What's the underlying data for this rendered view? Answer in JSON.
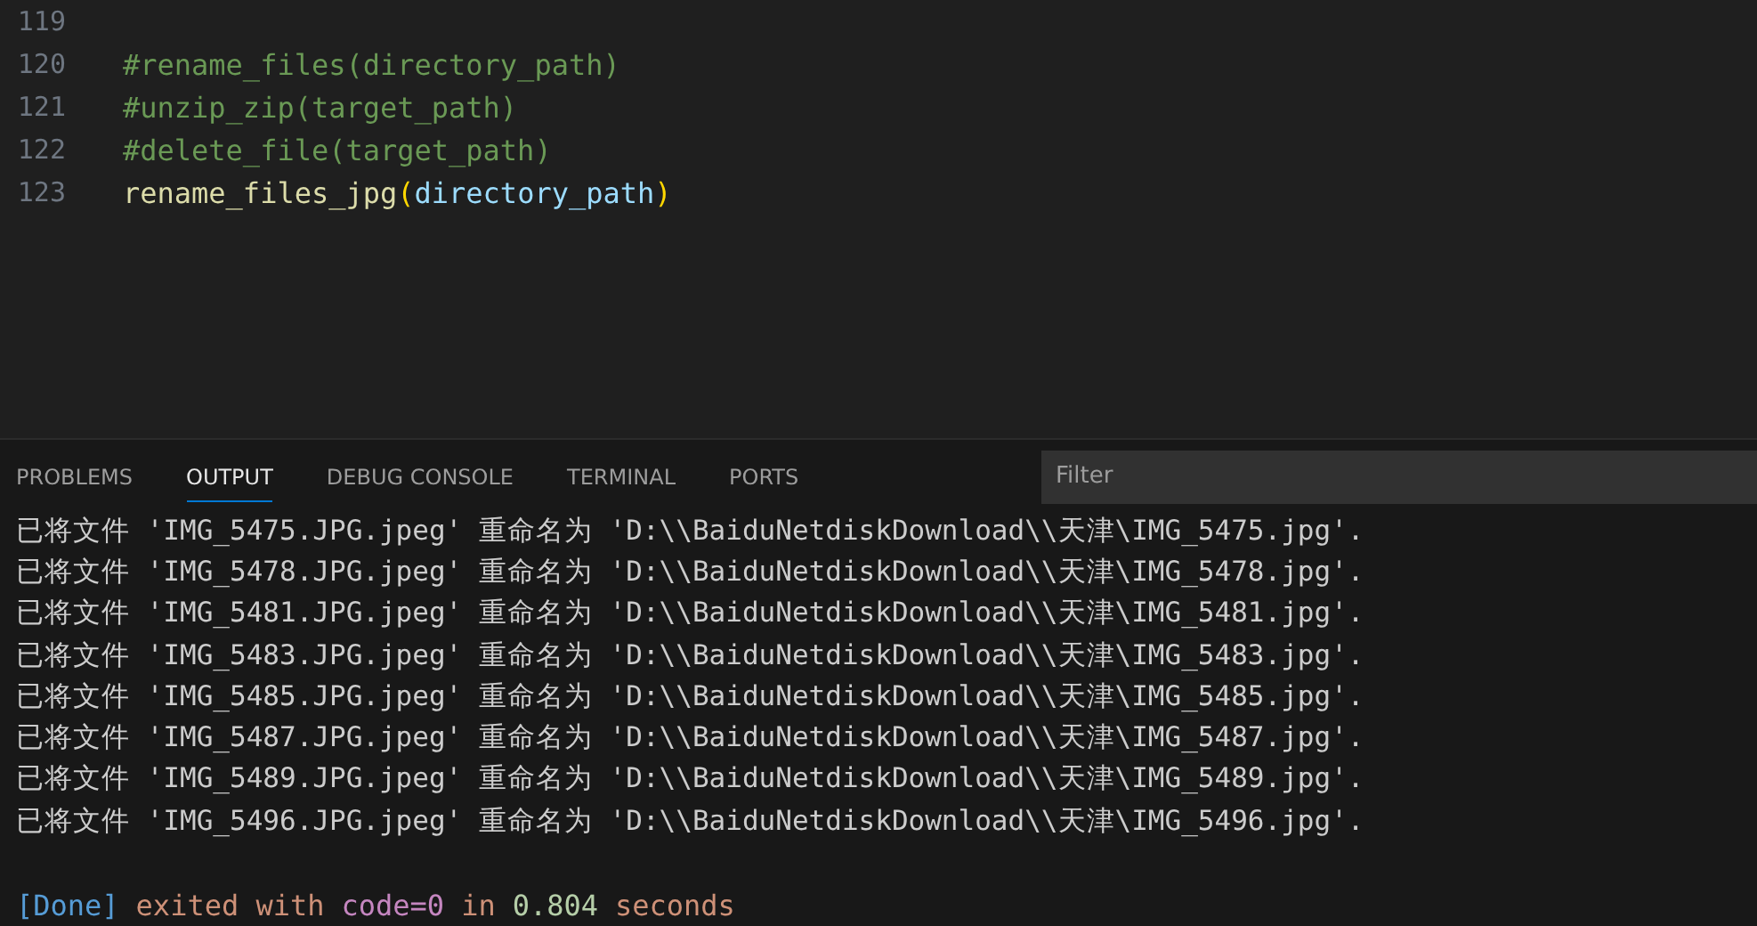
{
  "editor": {
    "lines": [
      {
        "number": "119"
      },
      {
        "number": "120",
        "tokens": [
          {
            "kind": "comment",
            "text": "#rename_files(directory_path)"
          }
        ]
      },
      {
        "number": "121",
        "tokens": [
          {
            "kind": "comment",
            "text": "#unzip_zip(target_path)"
          }
        ]
      },
      {
        "number": "122",
        "tokens": [
          {
            "kind": "comment",
            "text": "#delete_file(target_path)"
          }
        ]
      },
      {
        "number": "123",
        "tokens": [
          {
            "kind": "function",
            "text": "rename_files_jpg"
          },
          {
            "kind": "bracket",
            "text": "("
          },
          {
            "kind": "variable",
            "text": "directory_path"
          },
          {
            "kind": "bracket",
            "text": ")"
          }
        ]
      }
    ]
  },
  "panel": {
    "tabs": [
      {
        "label": "PROBLEMS",
        "selected": false
      },
      {
        "label": "OUTPUT",
        "selected": true
      },
      {
        "label": "DEBUG CONSOLE",
        "selected": false
      },
      {
        "label": "TERMINAL",
        "selected": false
      },
      {
        "label": "PORTS",
        "selected": false
      }
    ],
    "filter": {
      "placeholder": "Filter"
    },
    "output": [
      "已将文件 'IMG_5475.JPG.jpeg' 重命名为 'D:\\\\BaiduNetdiskDownload\\\\天津\\IMG_5475.jpg'.",
      "已将文件 'IMG_5478.JPG.jpeg' 重命名为 'D:\\\\BaiduNetdiskDownload\\\\天津\\IMG_5478.jpg'.",
      "已将文件 'IMG_5481.JPG.jpeg' 重命名为 'D:\\\\BaiduNetdiskDownload\\\\天津\\IMG_5481.jpg'.",
      "已将文件 'IMG_5483.JPG.jpeg' 重命名为 'D:\\\\BaiduNetdiskDownload\\\\天津\\IMG_5483.jpg'.",
      "已将文件 'IMG_5485.JPG.jpeg' 重命名为 'D:\\\\BaiduNetdiskDownload\\\\天津\\IMG_5485.jpg'.",
      "已将文件 'IMG_5487.JPG.jpeg' 重命名为 'D:\\\\BaiduNetdiskDownload\\\\天津\\IMG_5487.jpg'.",
      "已将文件 'IMG_5489.JPG.jpeg' 重命名为 'D:\\\\BaiduNetdiskDownload\\\\天津\\IMG_5489.jpg'.",
      "已将文件 'IMG_5496.JPG.jpeg' 重命名为 'D:\\\\BaiduNetdiskDownload\\\\天津\\IMG_5496.jpg'."
    ],
    "status_line": [
      {
        "kind": "tag",
        "text": "[Done]"
      },
      {
        "kind": "string",
        "text": "exited with"
      },
      {
        "kind": "keyword",
        "text": "code=0"
      },
      {
        "kind": "string",
        "text": "in"
      },
      {
        "kind": "number",
        "text": "0.804"
      },
      {
        "kind": "string",
        "text": "seconds"
      }
    ]
  }
}
